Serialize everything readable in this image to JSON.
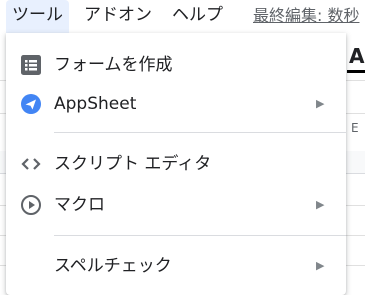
{
  "menubar": {
    "tools": "ツール",
    "addons": "アドオン",
    "help": "ヘルプ",
    "last_edit": "最終編集: 数秒"
  },
  "sheet": {
    "format_letter": "A",
    "column_e": "E"
  },
  "menu": {
    "items": [
      {
        "label": "フォームを作成",
        "icon": "form-icon",
        "submenu": false
      },
      {
        "label": "AppSheet",
        "icon": "appsheet-icon",
        "submenu": true
      },
      {
        "label": "スクリプト エディタ",
        "icon": "code-icon",
        "submenu": false
      },
      {
        "label": "マクロ",
        "icon": "macro-play-icon",
        "submenu": true
      },
      {
        "label": "スペルチェック",
        "icon": "",
        "submenu": true
      }
    ],
    "submenu_arrow": "▶"
  },
  "colors": {
    "active_menu_bg": "#e8f0fe",
    "appsheet_blue": "#4285f4",
    "icon_gray": "#5f6368"
  }
}
